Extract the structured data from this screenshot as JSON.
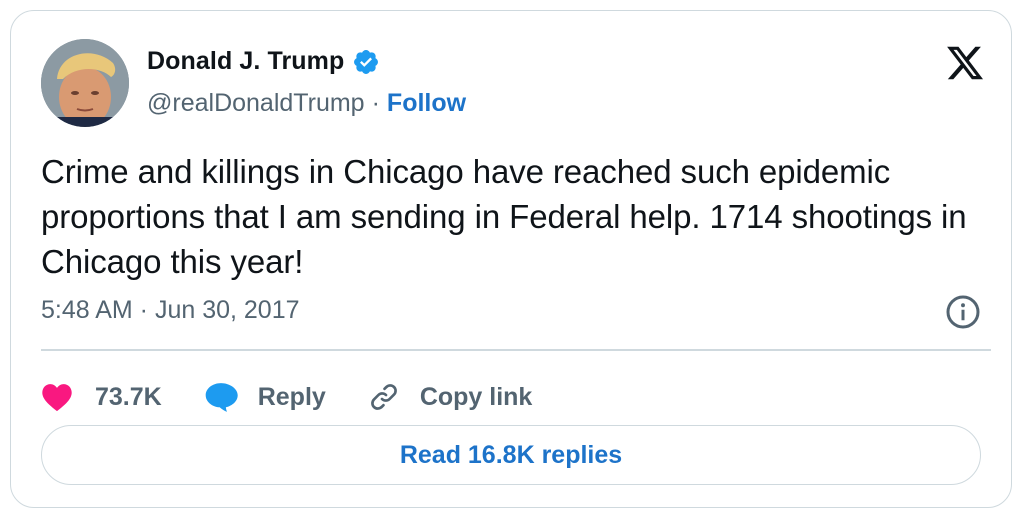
{
  "author": {
    "name": "Donald J. Trump",
    "handle": "@realDonaldTrump",
    "separator": "·",
    "follow_label": "Follow"
  },
  "tweet": {
    "text": "Crime and killings in Chicago have reached such epidemic proportions that I am sending in Federal help. 1714 shootings in Chicago this year!",
    "timestamp": "5:48 AM · Jun 30, 2017"
  },
  "actions": {
    "likes_count": "73.7K",
    "reply_label": "Reply",
    "copy_link_label": "Copy link"
  },
  "read_replies_label": "Read 16.8K replies",
  "icons": {
    "verified": "verified-badge-icon",
    "brand": "x-logo-icon",
    "info": "info-icon",
    "like": "heart-icon",
    "reply": "speech-bubble-icon",
    "copy": "link-icon"
  },
  "colors": {
    "accent": "#1d73c9",
    "heart": "#f91880",
    "reply_bubble": "#1d9bf0",
    "muted": "#536471",
    "border": "#cfd9de"
  }
}
